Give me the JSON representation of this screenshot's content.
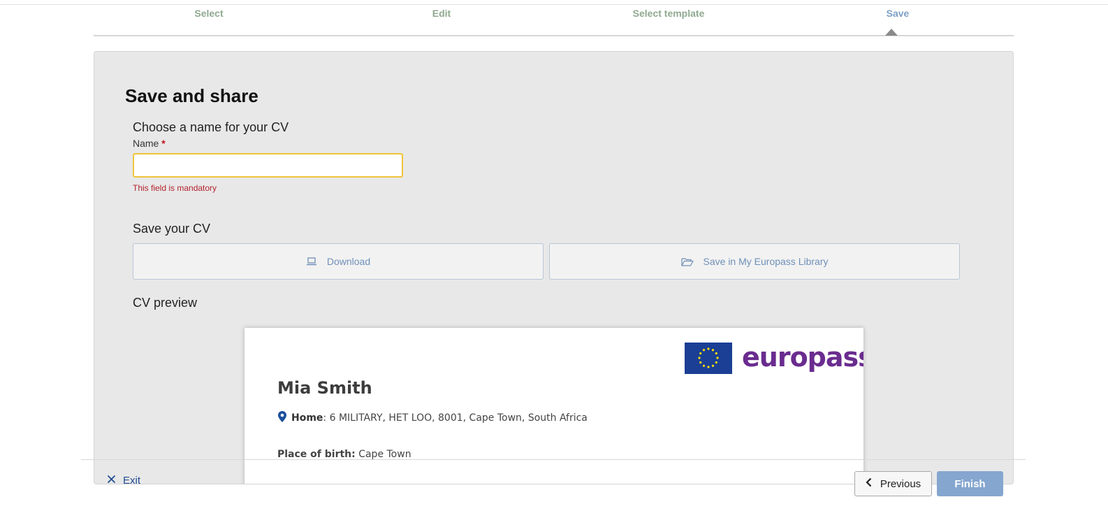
{
  "stepper": {
    "steps": [
      {
        "label": "Select"
      },
      {
        "label": "Edit"
      },
      {
        "label": "Select template"
      },
      {
        "label": "Save"
      }
    ]
  },
  "panel": {
    "title": "Save and share",
    "name_section": {
      "heading": "Choose a name for your CV",
      "label": "Name",
      "required_mark": "*",
      "value": "",
      "error": "This field is mandatory"
    },
    "save_section": {
      "heading": "Save your CV",
      "download_label": "Download",
      "library_label": "Save in My Europass Library"
    },
    "preview": {
      "heading": "CV preview",
      "logo_text": "europass",
      "name": "Mia Smith",
      "address_label": "Home",
      "address_value": ": 6 MILITARY, HET LOO, 8001, Cape Town, South Africa",
      "birth_label": "Place of birth:",
      "birth_value": "Cape Town"
    }
  },
  "footer": {
    "exit_label": "Exit",
    "previous_label": "Previous",
    "finish_label": "Finish"
  },
  "colors": {
    "step_done": "#8fa98f",
    "step_active": "#7d9fc4",
    "accent": "#1f4e91",
    "europass_purple": "#6a2c8f",
    "eu_blue": "#1b3f95",
    "eu_gold": "#ffde00"
  }
}
